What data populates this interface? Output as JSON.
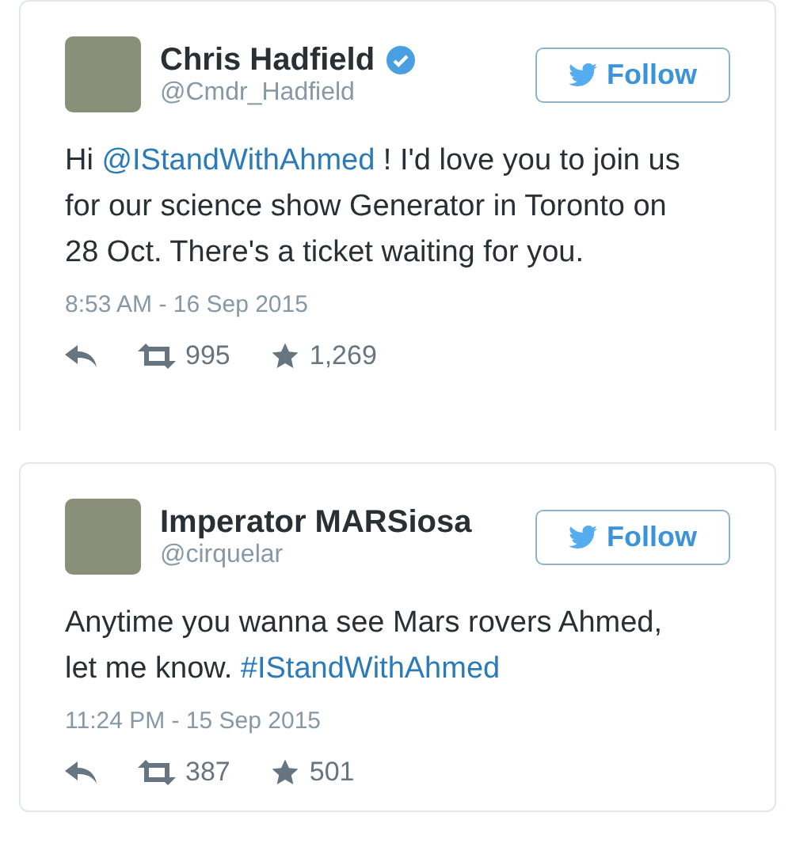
{
  "tweets": [
    {
      "name": "Chris Hadfield",
      "handle": "@Cmdr_Hadfield",
      "verified": true,
      "follow": "Follow",
      "text": [
        {
          "kind": "plain",
          "text": "Hi "
        },
        {
          "kind": "link",
          "text": "@IStandWithAhmed"
        },
        {
          "kind": "plain",
          "text": " ! I'd love you to join us for our science show Generator in Toronto on 28 Oct. There's a ticket waiting for you."
        }
      ],
      "time": "8:53 AM - 16 Sep 2015",
      "retweets": "995",
      "likes": "1,269",
      "cut": true
    },
    {
      "name": "Imperator MARSiosa",
      "handle": "@cirquelar",
      "verified": false,
      "follow": "Follow",
      "text": [
        {
          "kind": "plain",
          "text": "Anytime you wanna see Mars rovers Ahmed, let me know. "
        },
        {
          "kind": "link",
          "text": "#IStandWithAhmed"
        }
      ],
      "time": "11:24 PM - 15 Sep 2015",
      "retweets": "387",
      "likes": "501",
      "cut": false
    }
  ]
}
